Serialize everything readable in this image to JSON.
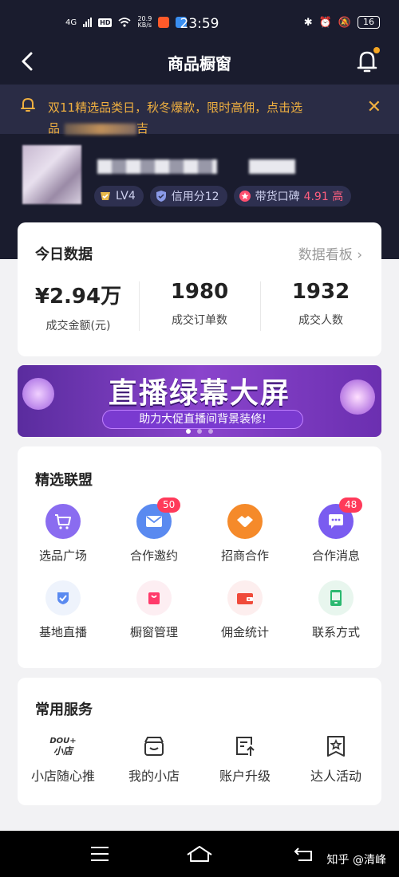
{
  "status_bar": {
    "network": "4G",
    "hd": "HD",
    "speed": "20.9",
    "speed_unit": "KB/s",
    "time": "23:59",
    "battery": "16"
  },
  "header": {
    "title": "商品橱窗"
  },
  "notice": {
    "text": "双11精选品类日，秋冬爆款，限时高佣，点击选",
    "text_line2_start": "品",
    "text_line2_end": "吉"
  },
  "profile": {
    "badges": [
      {
        "label": "LV4"
      },
      {
        "label": "信用分12"
      },
      {
        "label": "带货口碑",
        "value": "4.91 高"
      }
    ]
  },
  "today": {
    "title": "今日数据",
    "link": "数据看板",
    "stats": [
      {
        "value": "¥2.94万",
        "label": "成交金额(元)"
      },
      {
        "value": "1980",
        "label": "成交订单数"
      },
      {
        "value": "1932",
        "label": "成交人数"
      }
    ]
  },
  "banner": {
    "main": "直播绿幕大屏",
    "sub": "助力大促直播间背景装修!"
  },
  "alliance": {
    "title": "精选联盟",
    "items": [
      {
        "label": "选品广场",
        "icon": "cart-icon"
      },
      {
        "label": "合作邀约",
        "icon": "mail-icon",
        "badge": "50"
      },
      {
        "label": "招商合作",
        "icon": "handshake-icon"
      },
      {
        "label": "合作消息",
        "icon": "chat-icon",
        "badge": "48"
      },
      {
        "label": "基地直播",
        "icon": "shield-check-icon"
      },
      {
        "label": "橱窗管理",
        "icon": "bag-icon"
      },
      {
        "label": "佣金统计",
        "icon": "wallet-icon"
      },
      {
        "label": "联系方式",
        "icon": "phone-icon"
      }
    ]
  },
  "services": {
    "title": "常用服务",
    "items": [
      {
        "label": "小店随心推",
        "icon_line1": "DOU+",
        "icon_line2": "小店"
      },
      {
        "label": "我的小店",
        "icon": "shop-icon"
      },
      {
        "label": "账户升级",
        "icon": "upgrade-icon"
      },
      {
        "label": "达人活动",
        "icon": "star-badge-icon"
      }
    ]
  },
  "watermark": "知乎 @清峰",
  "colors": {
    "header_bg": "#1a1c2e",
    "notice_text": "#f0b040",
    "badge_red": "#ff3a5a",
    "banner_purple": "#8a44cc"
  }
}
